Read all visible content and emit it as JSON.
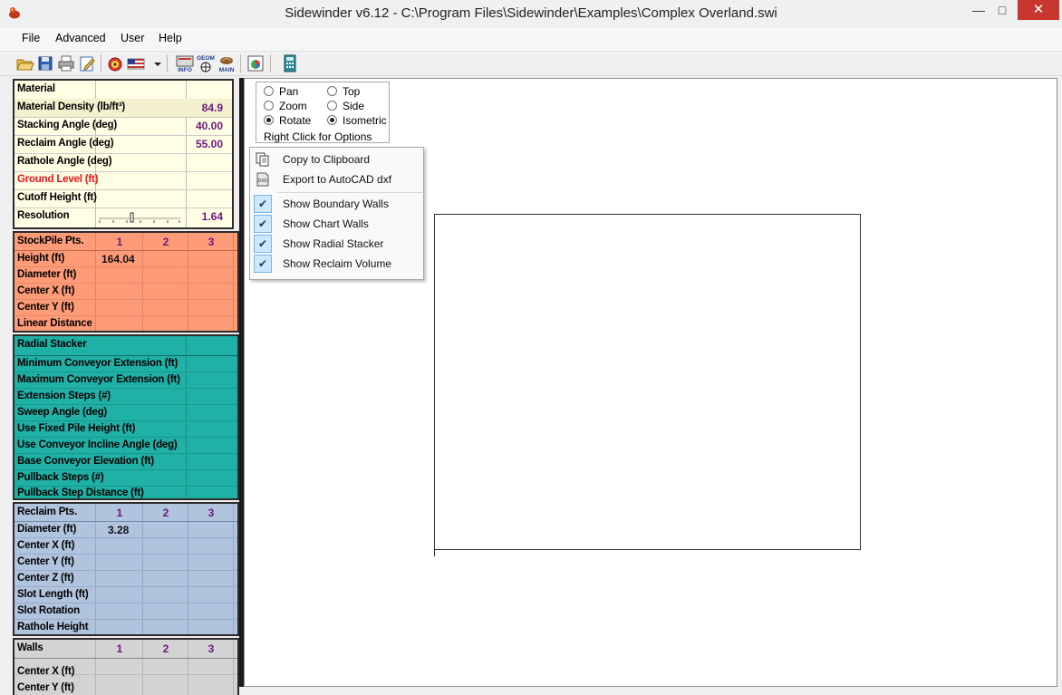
{
  "window": {
    "title": "Sidewinder v6.12 - C:\\Program Files\\Sidewinder\\Examples\\Complex Overland.swi",
    "minimize": "—",
    "maximize": "□",
    "close": "✕"
  },
  "menu": [
    "File",
    "Advanced",
    "User",
    "Help"
  ],
  "toolbar": {
    "icons": [
      "open-folder-icon",
      "save-icon",
      "print-icon",
      "edit-icon",
      "target-icon",
      "flag-icon",
      "dropdown-icon",
      "info-icon",
      "geom-icon",
      "main-icon",
      "chart-icon",
      "calculator-icon"
    ],
    "info_text": "INFO",
    "geom_text": "GEOM",
    "main_text": "MAIN"
  },
  "material": {
    "header": "Material",
    "rows": [
      {
        "label": "Material Density (lb/ft³)",
        "value": "84.9"
      },
      {
        "label": "Stacking Angle (deg)",
        "value": "40.00"
      },
      {
        "label": "Reclaim Angle (deg)",
        "value": "55.00"
      },
      {
        "label": "Rathole Angle (deg)",
        "value": ""
      },
      {
        "label": "Ground Level (ft)",
        "value": ""
      },
      {
        "label": "Cutoff Height (ft)",
        "value": ""
      },
      {
        "label": "Resolution",
        "value": "1.64"
      }
    ],
    "ground_color": "#e8151b",
    "bg": "#fffde3"
  },
  "stockpile": {
    "header": "StockPile Pts.",
    "cols": [
      "1",
      "2",
      "3"
    ],
    "rows": [
      {
        "label": "Height (ft)",
        "v1": "164.04"
      },
      {
        "label": "Diameter (ft)",
        "v1": ""
      },
      {
        "label": "Center X (ft)",
        "v1": ""
      },
      {
        "label": "Center Y (ft)",
        "v1": ""
      },
      {
        "label": "Linear Distance",
        "v1": ""
      }
    ],
    "bg": "#ff9b76"
  },
  "radial": {
    "header": "Radial Stacker",
    "rows": [
      "Minimum Conveyor Extension (ft)",
      "Maximum Conveyor Extension (ft)",
      "Extension Steps (#)",
      "Sweep Angle (deg)",
      "Use Fixed Pile Height (ft)",
      "Use Conveyor Incline Angle (deg)",
      "Base Conveyor Elevation (ft)",
      "Pullback Steps (#)",
      "Pullback Step Distance (ft)"
    ],
    "bg": "#1fb0a6"
  },
  "reclaim": {
    "header": "Reclaim Pts.",
    "cols": [
      "1",
      "2",
      "3"
    ],
    "rows": [
      {
        "label": "Diameter (ft)",
        "v1": "3.28"
      },
      {
        "label": "Center X (ft)",
        "v1": ""
      },
      {
        "label": "Center Y (ft)",
        "v1": ""
      },
      {
        "label": "Center Z (ft)",
        "v1": ""
      },
      {
        "label": "Slot Length (ft)",
        "v1": ""
      },
      {
        "label": "Slot Rotation",
        "v1": ""
      },
      {
        "label": "Rathole Height",
        "v1": ""
      }
    ],
    "bg": "#b0c4de"
  },
  "walls": {
    "header": "Walls",
    "cols": [
      "1",
      "2",
      "3"
    ],
    "rows": [
      "Center X (ft)",
      "Center Y (ft)"
    ],
    "bg": "#d3d3d3"
  },
  "view_controls": {
    "pan": "Pan",
    "zoom": "Zoom",
    "rotate": "Rotate",
    "top": "Top",
    "side": "Side",
    "isometric": "Isometric",
    "selected_left": "Rotate",
    "selected_right": "Isometric",
    "hint": "Right Click for Options"
  },
  "context_menu": {
    "copy": "Copy to Clipboard",
    "export": "Export to AutoCAD dxf",
    "checks": [
      {
        "label": "Show Boundary Walls",
        "checked": true
      },
      {
        "label": "Show Chart Walls",
        "checked": true
      },
      {
        "label": "Show Radial Stacker",
        "checked": true
      },
      {
        "label": "Show Reclaim Volume",
        "checked": true
      }
    ],
    "check_mark": "✔"
  }
}
